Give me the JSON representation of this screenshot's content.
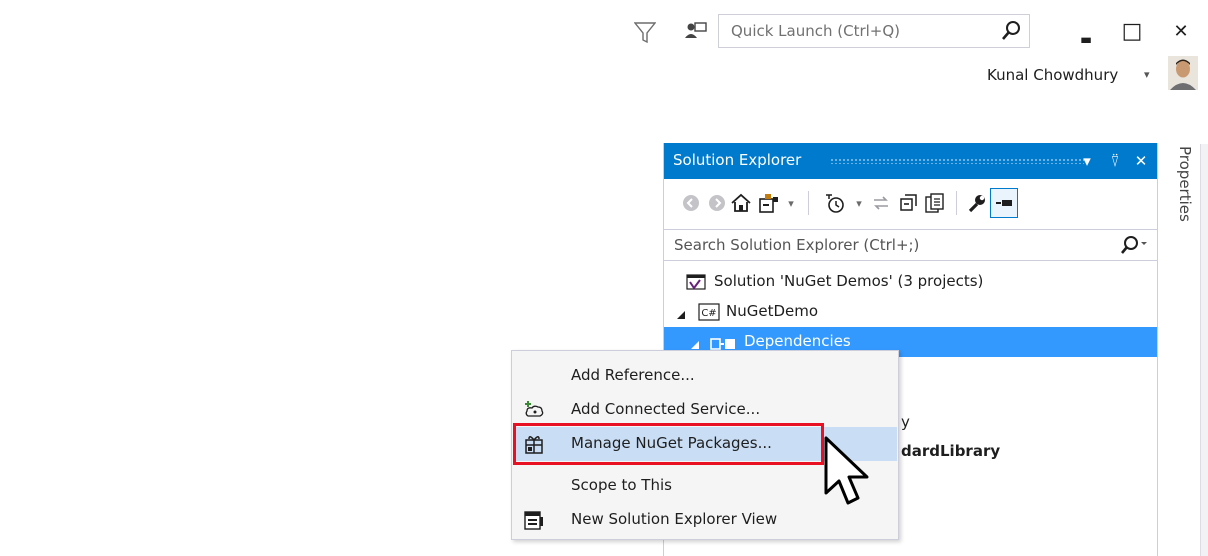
{
  "titlebar": {
    "quick_launch_placeholder": "Quick Launch (Ctrl+Q)",
    "minimize_glyph": "▃",
    "maximize_glyph": "□",
    "close_glyph": "✕",
    "user_name": "Kunal Chowdhury",
    "user_caret": "▾"
  },
  "properties_tab": {
    "label": "Properties"
  },
  "solution_explorer": {
    "title": "Solution Explorer",
    "header_buttons": {
      "dropdown": "▾",
      "pin": "⍢",
      "close": "✕"
    },
    "search_placeholder": "Search Solution Explorer (Ctrl+;)",
    "search_caret": "▾",
    "tree": {
      "solution": "Solution 'NuGet Demos' (3 projects)",
      "project": "NuGetDemo",
      "dependencies": "Dependencies",
      "partial_item_1": "y",
      "partial_item_2": "dardLibrary"
    },
    "accent": "#007acc",
    "selection_color": "#3399ff"
  },
  "context_menu": {
    "items": [
      {
        "label": "Add Reference...",
        "icon": ""
      },
      {
        "label": "Add Connected Service...",
        "icon": "connected-service-icon"
      },
      {
        "label": "Manage NuGet Packages...",
        "icon": "nuget-package-icon",
        "highlighted": true
      },
      {
        "label": "Scope to This",
        "icon": ""
      },
      {
        "label": "New Solution Explorer View",
        "icon": "new-view-icon"
      }
    ],
    "highlight_color": "#c9def5",
    "callout_color": "#e81123"
  }
}
